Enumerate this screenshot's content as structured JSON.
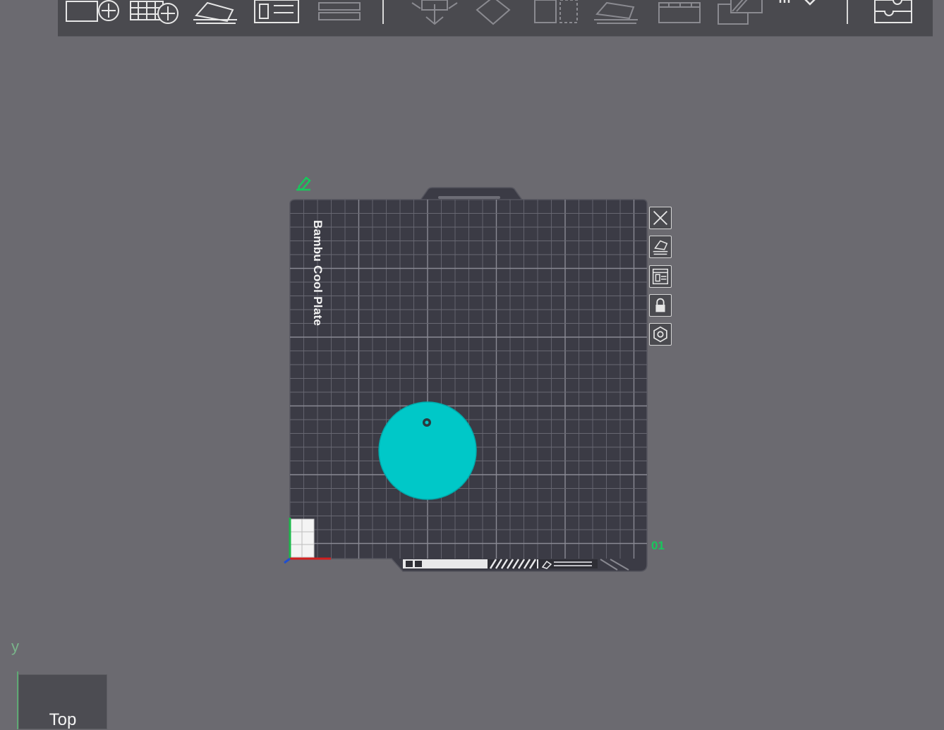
{
  "toolbar": {
    "buttons": [
      {
        "name": "add-object-button",
        "icon": "add-cube-icon"
      },
      {
        "name": "add-plate-button",
        "icon": "add-grid-icon"
      },
      {
        "name": "auto-orient-button",
        "icon": "orient-icon"
      },
      {
        "name": "arrange-button",
        "icon": "arrange-icon"
      },
      {
        "name": "split-button",
        "icon": "split-icon"
      },
      {
        "name": "move-button",
        "icon": "move-icon"
      },
      {
        "name": "rotate-button",
        "icon": "rotate-icon"
      },
      {
        "name": "mirror-button",
        "icon": "mirror-icon"
      },
      {
        "name": "lay-on-face-button",
        "icon": "lay-on-face-icon"
      },
      {
        "name": "cut-button",
        "icon": "cut-icon"
      },
      {
        "name": "support-paint-button",
        "icon": "support-icon"
      },
      {
        "name": "text-tool-button",
        "icon": "text-icon"
      },
      {
        "name": "assembly-button",
        "icon": "puzzle-icon"
      }
    ]
  },
  "plate": {
    "label": "Bambu Cool Plate",
    "number": "01",
    "edit_icon": "pencil-icon",
    "side_buttons": [
      {
        "name": "delete-plate-button",
        "icon": "close-icon"
      },
      {
        "name": "orient-plate-button",
        "icon": "orient-icon"
      },
      {
        "name": "arrange-plate-button",
        "icon": "arrange-icon"
      },
      {
        "name": "lock-plate-button",
        "icon": "lock-icon"
      },
      {
        "name": "plate-settings-button",
        "icon": "gear-icon"
      }
    ],
    "object": {
      "name": "round-tag-object",
      "color": "#00c8c8"
    }
  },
  "view": {
    "cube_label": "Top",
    "axis_label": "y"
  },
  "colors": {
    "background": "#6b6a70",
    "plate": "#3b3b45",
    "grid": "#6c6c76",
    "accent_green": "#18c75c",
    "object": "#00c8c8"
  }
}
